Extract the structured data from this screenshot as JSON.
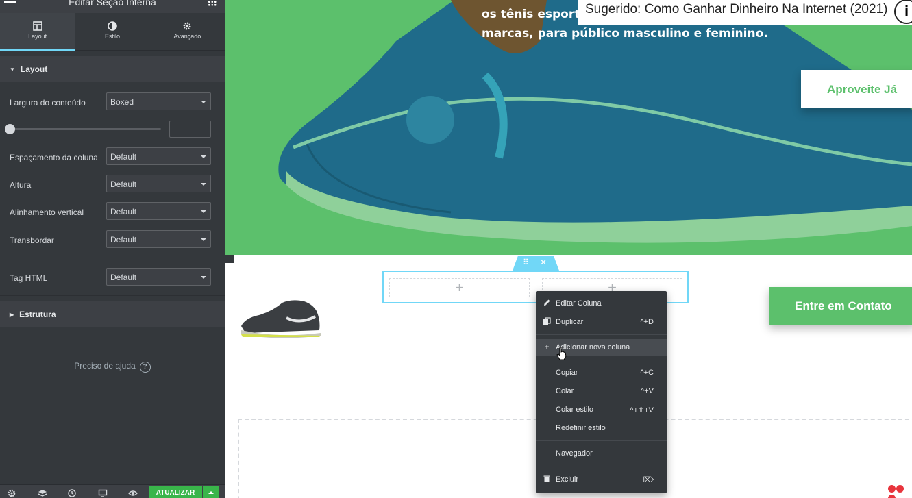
{
  "editor": {
    "title": "Editar Seção Interna",
    "tabs": [
      {
        "label": "Layout"
      },
      {
        "label": "Estilo"
      },
      {
        "label": "Avançado"
      }
    ],
    "layout_section": {
      "title": "Layout",
      "content_width": {
        "label": "Largura do conteúdo",
        "value": "Boxed"
      },
      "width_slider": {
        "value": 0
      },
      "column_gap": {
        "label": "Espaçamento da coluna",
        "value": "Default"
      },
      "height": {
        "label": "Altura",
        "value": "Default"
      },
      "vertical_align": {
        "label": "Alinhamento vertical",
        "value": "Default"
      },
      "overflow": {
        "label": "Transbordar",
        "value": "Default"
      },
      "html_tag": {
        "label": "Tag HTML",
        "value": "Default"
      }
    },
    "structure_section": {
      "title": "Estrutura"
    },
    "help": {
      "label": "Preciso de ajuda",
      "icon": "question-circle-icon"
    },
    "footer": {
      "update_label": "ATUALIZAR",
      "accent": "#39b54a"
    }
  },
  "canvas": {
    "hero_text_line1": "os tênis esportiv",
    "hero_text_line2": "marcas, para público masculino e feminino.",
    "cta_primary": "Aproveite Já",
    "cta_contact": "Entre em Contato",
    "hero_color": "#5cc06c",
    "selection_color": "#71d7f7",
    "empty_column_symbol": "+"
  },
  "overlay": {
    "suggestion": "Sugerido: Como Ganhar Dinheiro Na Internet (2021)",
    "info_symbol": "i"
  },
  "context_menu": {
    "items": [
      {
        "label": "Editar Coluna",
        "icon": "pencil-icon",
        "shortcut": ""
      },
      {
        "label": "Duplicar",
        "icon": "copy-icon",
        "shortcut": "^+D"
      },
      {
        "label": "Adicionar nova coluna",
        "icon": "plus-icon",
        "shortcut": ""
      },
      {
        "label": "Copiar",
        "icon": "",
        "shortcut": "^+C"
      },
      {
        "label": "Colar",
        "icon": "",
        "shortcut": "^+V"
      },
      {
        "label": "Colar estilo",
        "icon": "",
        "shortcut": "^+⇧+V"
      },
      {
        "label": "Redefinir estilo",
        "icon": "",
        "shortcut": ""
      },
      {
        "label": "Navegador",
        "icon": "",
        "shortcut": ""
      },
      {
        "label": "Excluir",
        "icon": "trash-icon",
        "shortcut": "⌦"
      }
    ],
    "hovered_index": 2
  }
}
